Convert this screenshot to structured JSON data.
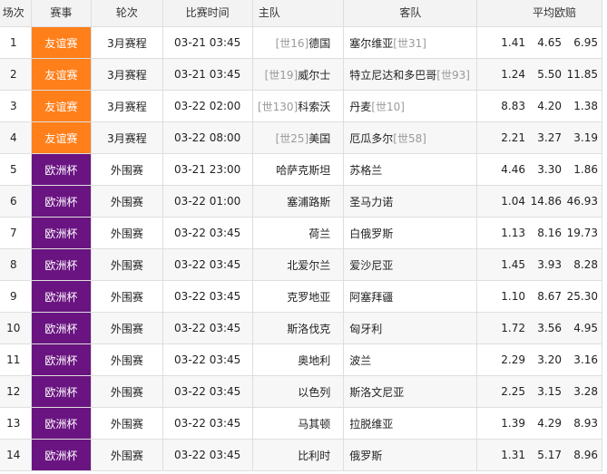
{
  "headers": {
    "num": "场次",
    "event": "赛事",
    "round": "轮次",
    "time": "比赛时间",
    "home": "主队",
    "away": "客队",
    "odds": "平均欧赔"
  },
  "colors": {
    "friendly": "#ff7f1a",
    "euro": "#6a1481"
  },
  "rows": [
    {
      "num": "1",
      "event": "友谊赛",
      "event_type": "friendly",
      "round": "3月赛程",
      "time": "03-21 03:45",
      "home": "德国",
      "home_rank": "[世16]",
      "away": "塞尔维亚",
      "away_rank": "[世31]",
      "odds": [
        "1.41",
        "4.65",
        "6.95"
      ]
    },
    {
      "num": "2",
      "event": "友谊赛",
      "event_type": "friendly",
      "round": "3月赛程",
      "time": "03-21 03:45",
      "home": "威尔士",
      "home_rank": "[世19]",
      "away": "特立尼达和多巴哥",
      "away_rank": "[世93]",
      "odds": [
        "1.24",
        "5.50",
        "11.85"
      ]
    },
    {
      "num": "3",
      "event": "友谊赛",
      "event_type": "friendly",
      "round": "3月赛程",
      "time": "03-22 02:00",
      "home": "科索沃",
      "home_rank": "[世130]",
      "away": "丹麦",
      "away_rank": "[世10]",
      "odds": [
        "8.83",
        "4.20",
        "1.38"
      ]
    },
    {
      "num": "4",
      "event": "友谊赛",
      "event_type": "friendly",
      "round": "3月赛程",
      "time": "03-22 08:00",
      "home": "美国",
      "home_rank": "[世25]",
      "away": "厄瓜多尔",
      "away_rank": "[世58]",
      "odds": [
        "2.21",
        "3.27",
        "3.19"
      ]
    },
    {
      "num": "5",
      "event": "欧洲杯",
      "event_type": "euro",
      "round": "外围赛",
      "time": "03-21 23:00",
      "home": "哈萨克斯坦",
      "home_rank": "",
      "away": "苏格兰",
      "away_rank": "",
      "odds": [
        "4.46",
        "3.30",
        "1.86"
      ]
    },
    {
      "num": "6",
      "event": "欧洲杯",
      "event_type": "euro",
      "round": "外围赛",
      "time": "03-22 01:00",
      "home": "塞浦路斯",
      "home_rank": "",
      "away": "圣马力诺",
      "away_rank": "",
      "odds": [
        "1.04",
        "14.86",
        "46.93"
      ]
    },
    {
      "num": "7",
      "event": "欧洲杯",
      "event_type": "euro",
      "round": "外围赛",
      "time": "03-22 03:45",
      "home": "荷兰",
      "home_rank": "",
      "away": "白俄罗斯",
      "away_rank": "",
      "odds": [
        "1.13",
        "8.16",
        "19.73"
      ]
    },
    {
      "num": "8",
      "event": "欧洲杯",
      "event_type": "euro",
      "round": "外围赛",
      "time": "03-22 03:45",
      "home": "北爱尔兰",
      "home_rank": "",
      "away": "爱沙尼亚",
      "away_rank": "",
      "odds": [
        "1.45",
        "3.93",
        "8.28"
      ]
    },
    {
      "num": "9",
      "event": "欧洲杯",
      "event_type": "euro",
      "round": "外围赛",
      "time": "03-22 03:45",
      "home": "克罗地亚",
      "home_rank": "",
      "away": "阿塞拜疆",
      "away_rank": "",
      "odds": [
        "1.10",
        "8.67",
        "25.30"
      ]
    },
    {
      "num": "10",
      "event": "欧洲杯",
      "event_type": "euro",
      "round": "外围赛",
      "time": "03-22 03:45",
      "home": "斯洛伐克",
      "home_rank": "",
      "away": "匈牙利",
      "away_rank": "",
      "odds": [
        "1.72",
        "3.56",
        "4.95"
      ]
    },
    {
      "num": "11",
      "event": "欧洲杯",
      "event_type": "euro",
      "round": "外围赛",
      "time": "03-22 03:45",
      "home": "奥地利",
      "home_rank": "",
      "away": "波兰",
      "away_rank": "",
      "odds": [
        "2.29",
        "3.20",
        "3.16"
      ]
    },
    {
      "num": "12",
      "event": "欧洲杯",
      "event_type": "euro",
      "round": "外围赛",
      "time": "03-22 03:45",
      "home": "以色列",
      "home_rank": "",
      "away": "斯洛文尼亚",
      "away_rank": "",
      "odds": [
        "2.25",
        "3.15",
        "3.28"
      ]
    },
    {
      "num": "13",
      "event": "欧洲杯",
      "event_type": "euro",
      "round": "外围赛",
      "time": "03-22 03:45",
      "home": "马其顿",
      "home_rank": "",
      "away": "拉脱维亚",
      "away_rank": "",
      "odds": [
        "1.39",
        "4.29",
        "8.93"
      ]
    },
    {
      "num": "14",
      "event": "欧洲杯",
      "event_type": "euro",
      "round": "外围赛",
      "time": "03-22 03:45",
      "home": "比利时",
      "home_rank": "",
      "away": "俄罗斯",
      "away_rank": "",
      "odds": [
        "1.31",
        "5.17",
        "8.96"
      ]
    }
  ]
}
